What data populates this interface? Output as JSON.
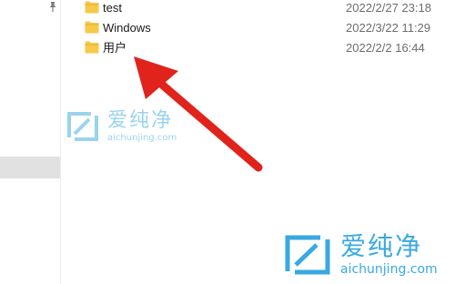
{
  "files": [
    {
      "name": "test",
      "date": "2022/2/27 23:18",
      "icon": "folder-icon"
    },
    {
      "name": "Windows",
      "date": "2022/3/22 11:29",
      "icon": "folder-icon"
    },
    {
      "name": "用户",
      "date": "2022/2/2 16:44",
      "icon": "folder-icon"
    }
  ],
  "nav": {
    "pin_icon": "pin-icon"
  },
  "watermark": {
    "brand": "爱纯净",
    "url": "aichunjing.com",
    "color": "#39a9e0"
  },
  "colors": {
    "folder": "#f7c948",
    "arrow": "#e0231b"
  }
}
